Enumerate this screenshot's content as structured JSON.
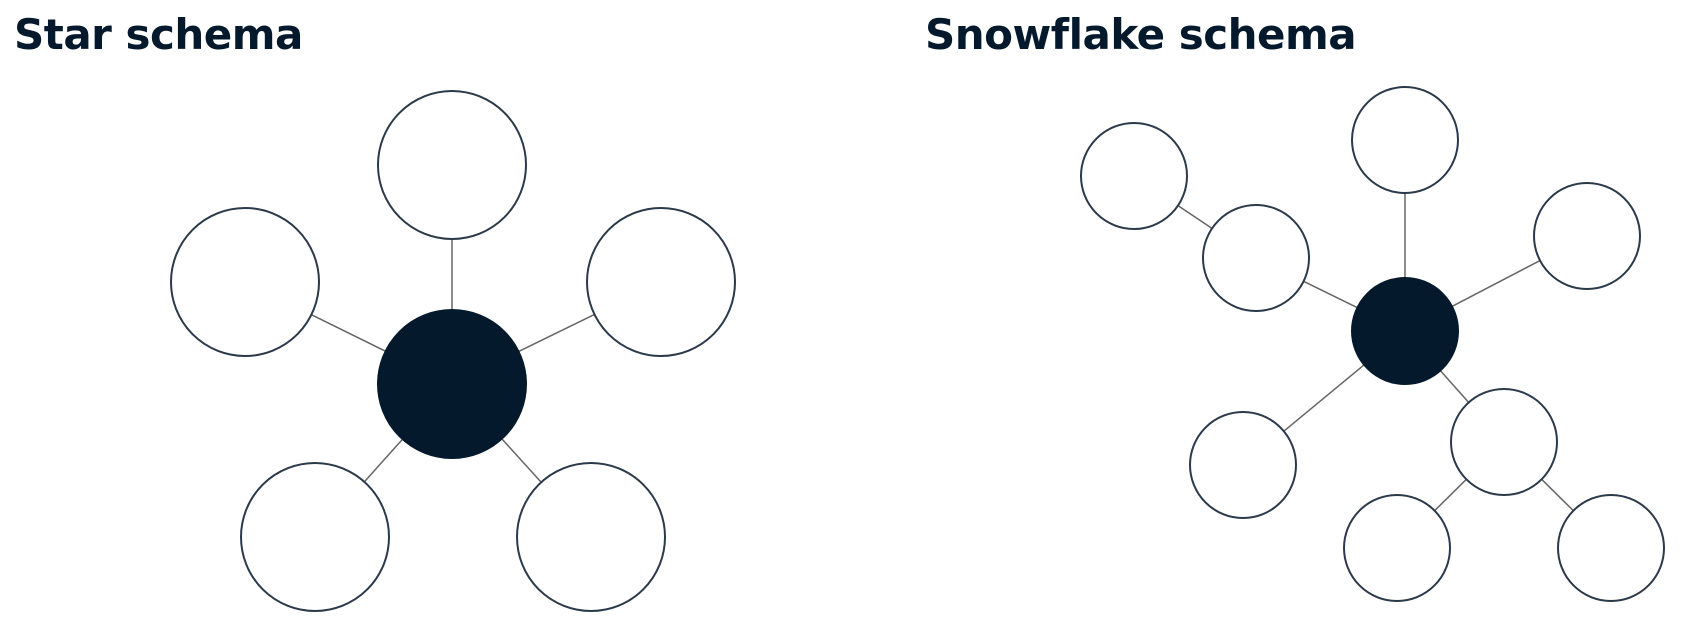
{
  "colors": {
    "title_text": "#05192d",
    "fact_fill": "#05192d",
    "dimension_stroke": "#2b3a4a",
    "dimension_fill": "#ffffff",
    "edge": "#666666",
    "background": "#ffffff"
  },
  "star": {
    "title": "Star schema",
    "nodes": [
      {
        "id": "fact",
        "kind": "fact"
      },
      {
        "id": "dim-top",
        "kind": "dimension"
      },
      {
        "id": "dim-left",
        "kind": "dimension"
      },
      {
        "id": "dim-right",
        "kind": "dimension"
      },
      {
        "id": "dim-bottom-left",
        "kind": "dimension"
      },
      {
        "id": "dim-bottom-right",
        "kind": "dimension"
      }
    ],
    "edges": [
      [
        "fact",
        "dim-top"
      ],
      [
        "fact",
        "dim-left"
      ],
      [
        "fact",
        "dim-right"
      ],
      [
        "fact",
        "dim-bottom-left"
      ],
      [
        "fact",
        "dim-bottom-right"
      ]
    ]
  },
  "snowflake": {
    "title": "Snowflake schema",
    "nodes": [
      {
        "id": "fact",
        "kind": "fact"
      },
      {
        "id": "dim-top",
        "kind": "dimension"
      },
      {
        "id": "dim-right",
        "kind": "dimension"
      },
      {
        "id": "dim-left",
        "kind": "dimension"
      },
      {
        "id": "dim-left-sub",
        "kind": "sub-dimension"
      },
      {
        "id": "dim-bottom-left",
        "kind": "dimension"
      },
      {
        "id": "dim-bottom-right",
        "kind": "dimension"
      },
      {
        "id": "dim-bottom-right-sub-left",
        "kind": "sub-dimension"
      },
      {
        "id": "dim-bottom-right-sub-right",
        "kind": "sub-dimension"
      }
    ],
    "edges": [
      [
        "fact",
        "dim-top"
      ],
      [
        "fact",
        "dim-right"
      ],
      [
        "fact",
        "dim-left"
      ],
      [
        "dim-left",
        "dim-left-sub"
      ],
      [
        "fact",
        "dim-bottom-left"
      ],
      [
        "fact",
        "dim-bottom-right"
      ],
      [
        "dim-bottom-right",
        "dim-bottom-right-sub-left"
      ],
      [
        "dim-bottom-right",
        "dim-bottom-right-sub-right"
      ]
    ]
  }
}
